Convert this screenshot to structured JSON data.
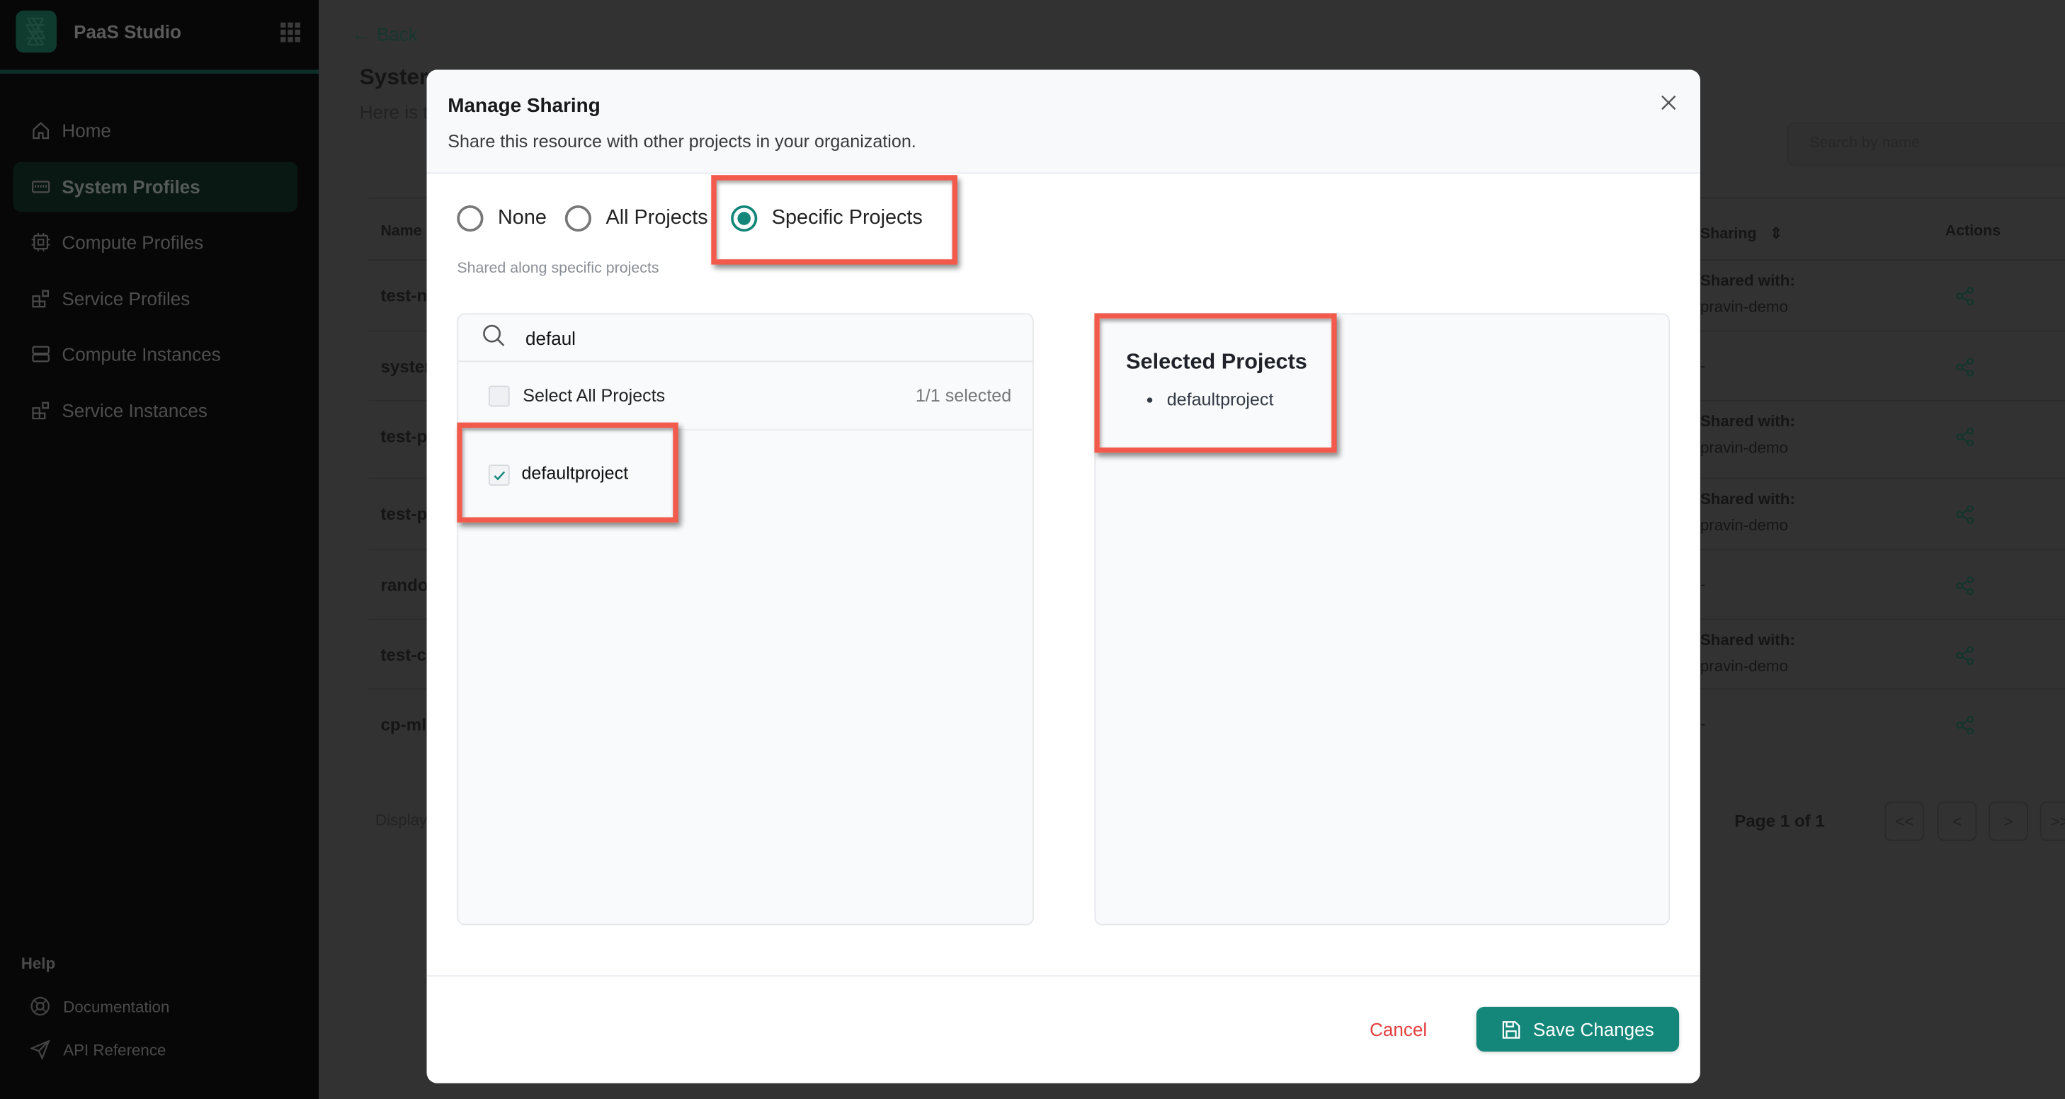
{
  "sidebar": {
    "brand": "PaaS Studio",
    "items": [
      {
        "label": "Home",
        "icon": "home-icon"
      },
      {
        "label": "System Profiles",
        "icon": "keyboard-icon",
        "active": true
      },
      {
        "label": "Compute Profiles",
        "icon": "cpu-icon"
      },
      {
        "label": "Service Profiles",
        "icon": "blocks-icon"
      },
      {
        "label": "Compute Instances",
        "icon": "server-icon"
      },
      {
        "label": "Service Instances",
        "icon": "blocks-icon"
      }
    ],
    "help_heading": "Help",
    "help_items": [
      {
        "label": "Documentation",
        "icon": "lifebuoy-icon"
      },
      {
        "label": "API Reference",
        "icon": "send-icon"
      }
    ]
  },
  "background_page": {
    "back_label": "Back",
    "title": "Syster",
    "subtitle": "Here is t",
    "search_placeholder": "Search by name",
    "columns": {
      "name": "Name",
      "sharing": "Sharing",
      "actions": "Actions"
    },
    "rows": [
      {
        "name": "test-n",
        "shared_label": "Shared with:",
        "shared_value": "pravin-demo"
      },
      {
        "name": "syster",
        "shared_label": "",
        "shared_value": "-"
      },
      {
        "name": "test-p",
        "shared_label": "Shared with:",
        "shared_value": "pravin-demo"
      },
      {
        "name": "test-p",
        "shared_label": "Shared with:",
        "shared_value": "pravin-demo"
      },
      {
        "name": "rando",
        "shared_label": "",
        "shared_value": "-"
      },
      {
        "name": "test-c",
        "shared_label": "Shared with:",
        "shared_value": "pravin-demo"
      },
      {
        "name": "cp-ml",
        "shared_label": "",
        "shared_value": "-"
      }
    ],
    "display_text": "Display",
    "page_text": "Page 1 of 1",
    "pagination": [
      "<<",
      "<",
      ">",
      ">>"
    ]
  },
  "modal": {
    "title": "Manage Sharing",
    "subtitle": "Share this resource with other projects in your organization.",
    "options": [
      "None",
      "All Projects",
      "Specific Projects"
    ],
    "selected_option": "Specific Projects",
    "hint": "Shared along specific projects",
    "search_value": "defaul",
    "select_all_label": "Select All Projects",
    "selected_count": "1/1 selected",
    "projects": [
      {
        "label": "defaultproject",
        "checked": true
      }
    ],
    "selected_heading": "Selected Projects",
    "selected_projects": [
      "defaultproject"
    ],
    "cancel_label": "Cancel",
    "save_label": "Save Changes"
  },
  "colors": {
    "accent": "#14877a",
    "cancel": "#e53e3e",
    "highlight": "#f25a4c"
  }
}
